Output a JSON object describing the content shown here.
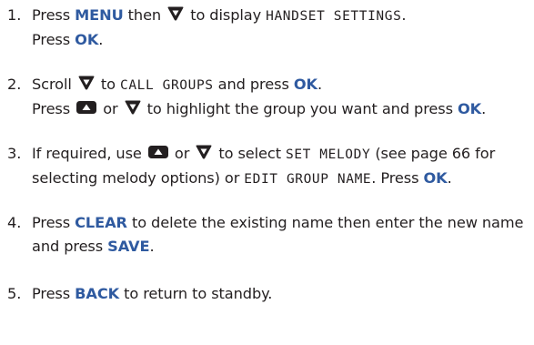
{
  "steps": [
    {
      "num": "1.",
      "p1": "Press ",
      "menu": "MENU",
      "p2": " then ",
      "p3": " to display ",
      "lcd_handset": "HANDSET SETTINGS",
      "p4": ".",
      "p5": "Press ",
      "ok": "OK",
      "p6": "."
    },
    {
      "num": "2.",
      "p1": "Scroll ",
      "p2": " to ",
      "lcd_call_groups": "CALL GROUPS",
      "p3": " and press ",
      "ok1": "OK",
      "p4": ".",
      "p5": "Press ",
      "p6": " or ",
      "p7": " to highlight the group you want and press ",
      "ok2": "OK",
      "p8": "."
    },
    {
      "num": "3.",
      "p1": "If required, use ",
      "p2": " or ",
      "p3": " to select ",
      "lcd_set_melody": "SET MELODY",
      "p4": " (see page 66 for selecting melody options) or ",
      "lcd_edit_group_name": "EDIT GROUP NAME",
      "p5": ". Press ",
      "ok": "OK",
      "p6": "."
    },
    {
      "num": "4.",
      "p1": "Press ",
      "clear": "CLEAR",
      "p2": " to delete the existing name then enter the new name and press ",
      "save": "SAVE",
      "p3": "."
    },
    {
      "num": "5.",
      "p1": "Press ",
      "back": "BACK",
      "p2": " to return to standby."
    }
  ],
  "icons": {
    "down": "down-arrow-key-icon",
    "up": "up-arrow-key-icon"
  },
  "colors": {
    "keyword": "#2f5aa0",
    "text": "#231f20",
    "key_icon": "#231f20"
  }
}
